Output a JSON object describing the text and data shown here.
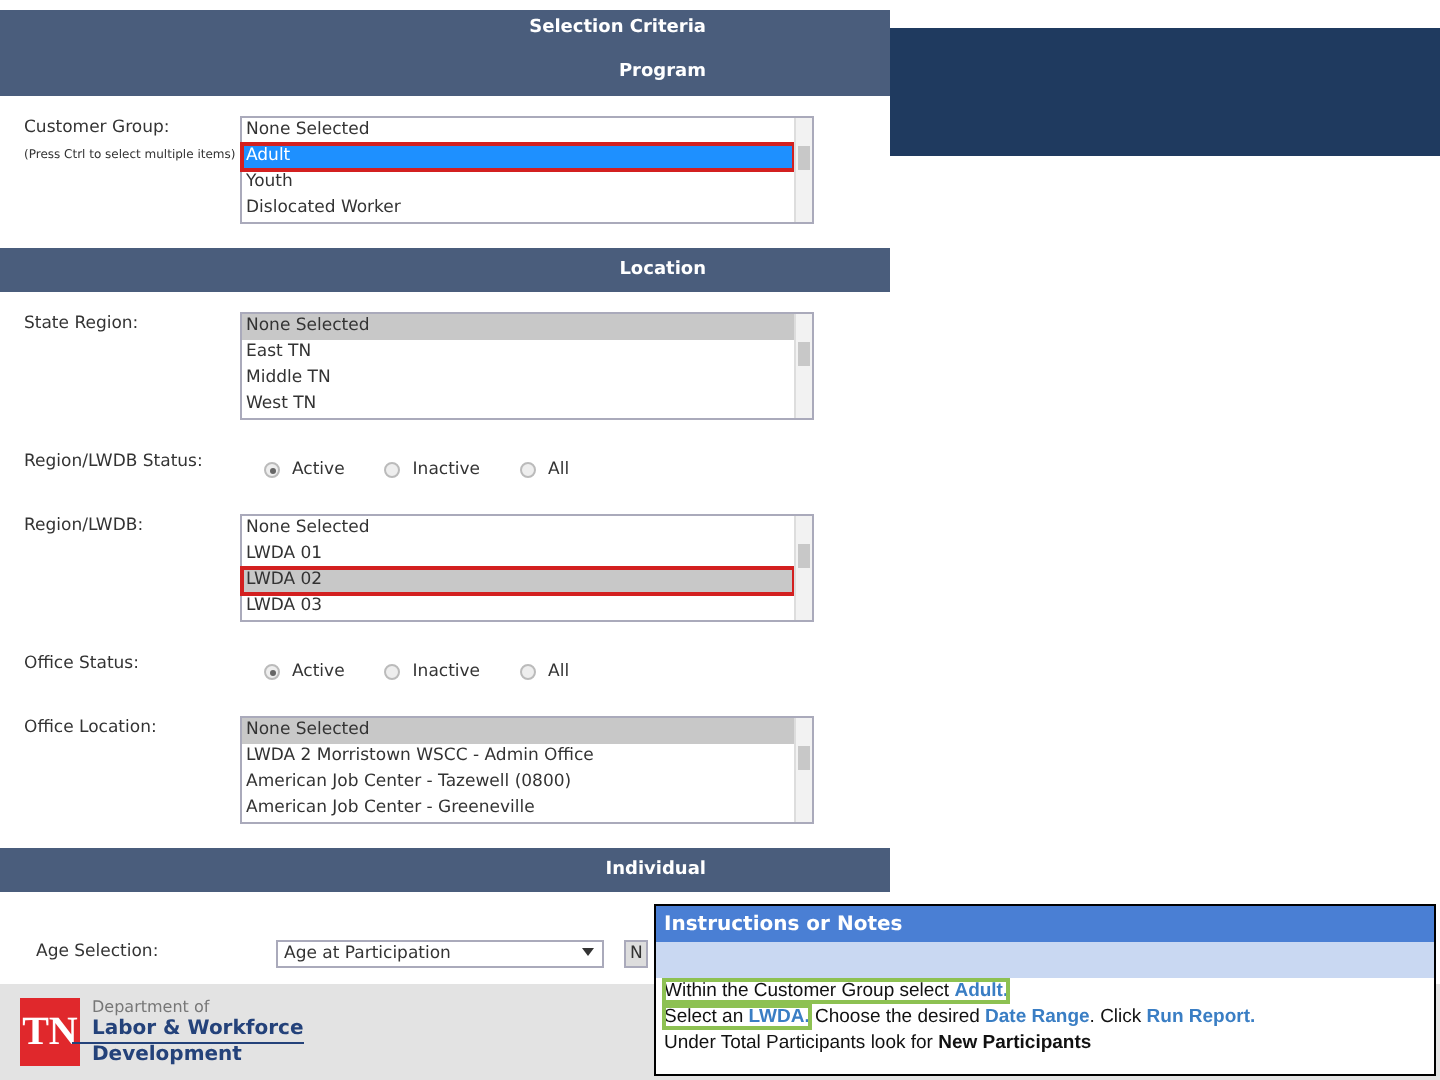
{
  "sections": [
    {
      "header_lines": [
        "Selection Criteria",
        "Program"
      ],
      "fields": [
        {
          "kind": "listbox",
          "label": "Customer Group:",
          "hint": "(Press Ctrl to select multiple items)",
          "focused": true,
          "options": [
            {
              "text": "None Selected",
              "selected": false,
              "callout": false
            },
            {
              "text": "Adult",
              "selected": true,
              "callout": true
            },
            {
              "text": "Youth",
              "selected": false,
              "callout": false
            },
            {
              "text": "Dislocated Worker",
              "selected": false,
              "callout": false
            }
          ]
        }
      ]
    },
    {
      "header_lines": [
        "Location"
      ],
      "fields": [
        {
          "kind": "listbox",
          "label": "State Region:",
          "focused": false,
          "options": [
            {
              "text": "None Selected",
              "selected": true,
              "callout": false
            },
            {
              "text": "East TN",
              "selected": false,
              "callout": false
            },
            {
              "text": "Middle TN",
              "selected": false,
              "callout": false
            },
            {
              "text": "West TN",
              "selected": false,
              "callout": false
            }
          ]
        },
        {
          "kind": "radio",
          "label": "Region/LWDB Status:",
          "options": [
            {
              "text": "Active",
              "selected": true
            },
            {
              "text": "Inactive",
              "selected": false
            },
            {
              "text": "All",
              "selected": false
            }
          ]
        },
        {
          "kind": "listbox",
          "label": "Region/LWDB:",
          "focused": false,
          "options": [
            {
              "text": "None Selected",
              "selected": false,
              "callout": false
            },
            {
              "text": "LWDA 01",
              "selected": false,
              "callout": false
            },
            {
              "text": "LWDA 02",
              "selected": true,
              "callout": true
            },
            {
              "text": "LWDA 03",
              "selected": false,
              "callout": false
            }
          ]
        },
        {
          "kind": "radio",
          "label": "Office Status:",
          "options": [
            {
              "text": "Active",
              "selected": true
            },
            {
              "text": "Inactive",
              "selected": false
            },
            {
              "text": "All",
              "selected": false
            }
          ]
        },
        {
          "kind": "listbox",
          "label": "Office Location:",
          "focused": false,
          "options": [
            {
              "text": "None Selected",
              "selected": true,
              "callout": false
            },
            {
              "text": "LWDA 2 Morristown WSCC - Admin Office",
              "selected": false,
              "callout": false
            },
            {
              "text": "American Job Center - Tazewell (0800)",
              "selected": false,
              "callout": false
            },
            {
              "text": "American Job Center - Greeneville",
              "selected": false,
              "callout": false
            }
          ]
        }
      ]
    },
    {
      "header_lines": [
        "Individual"
      ],
      "fields": [
        {
          "kind": "dropdown",
          "label": "Age Selection:",
          "value": "Age at Participation",
          "extra": "N"
        }
      ]
    }
  ],
  "logo": {
    "mark": "TN",
    "line1": "Department of",
    "line2": "Labor & Workforce",
    "line3": "Development"
  },
  "notes": {
    "title": "Instructions or Notes",
    "lines": [
      [
        {
          "boxed": true,
          "segments": [
            {
              "text": "Within the Customer Group select ",
              "kind": "plain"
            },
            {
              "text": "Adult.",
              "kind": "link"
            }
          ]
        }
      ],
      [
        {
          "boxed": true,
          "segments": [
            {
              "text": "Select an ",
              "kind": "plain"
            },
            {
              "text": "LWDA.",
              "kind": "link"
            }
          ]
        },
        {
          "boxed": false,
          "segments": [
            {
              "text": " Choose the desired ",
              "kind": "plain"
            },
            {
              "text": "Date Range",
              "kind": "link"
            },
            {
              "text": ". Click ",
              "kind": "plain"
            },
            {
              "text": "Run Report.",
              "kind": "link"
            }
          ]
        }
      ],
      [
        {
          "boxed": false,
          "segments": [
            {
              "text": "Under Total Participants look for ",
              "kind": "plain"
            },
            {
              "text": "New Participants",
              "kind": "strong"
            }
          ]
        }
      ]
    ]
  }
}
